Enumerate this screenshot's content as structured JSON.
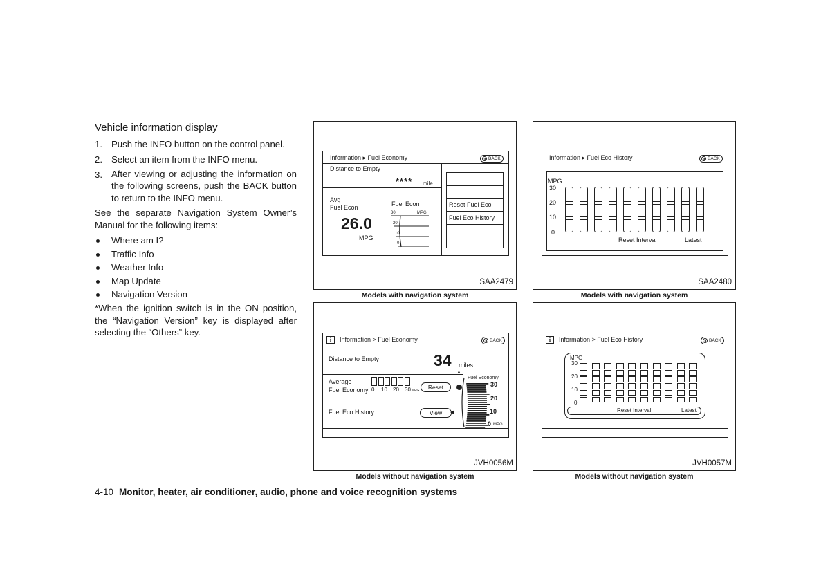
{
  "left_column": {
    "section_title": "Vehicle information display",
    "steps": [
      {
        "num": "1.",
        "text": "Push the INFO button on the control panel."
      },
      {
        "num": "2.",
        "text": "Select an item from the INFO menu."
      },
      {
        "num": "3.",
        "text": "After viewing or adjusting the information on the following screens, push the BACK button to return to the INFO menu."
      }
    ],
    "see_text": "See the separate Navigation System Owner’s Manual for the following items:",
    "bullets": [
      "Where am I?",
      "Traffic Info",
      "Weather Info",
      "Map Update",
      "Navigation Version"
    ],
    "note": "*When the ignition switch is in the ON position, the “Navigation Version” key is displayed after selecting the “Others” key."
  },
  "figures": [
    {
      "code": "SAA2479",
      "caption": "Models with navigation system",
      "screen": {
        "breadcrumb": "Information ▸ Fuel Economy",
        "back_label": "BACK",
        "distance_label": "Distance to Empty",
        "distance_value": "****",
        "distance_unit": "mile",
        "avg_label_1": "Avg",
        "avg_label_2": "Fuel Econ",
        "avg_value": "26.0",
        "avg_unit": "MPG",
        "gauge_title": "Fuel Econ",
        "gauge_ticks": [
          "30",
          "20",
          "10",
          "0"
        ],
        "gauge_unit": "MPG",
        "menu_items": [
          "",
          "",
          "Reset Fuel Eco",
          "Fuel Eco History",
          ""
        ]
      }
    },
    {
      "code": "SAA2480",
      "caption": "Models with navigation system",
      "screen": {
        "breadcrumb": "Information ▸ Fuel Eco History",
        "back_label": "BACK",
        "y_label": "MPG",
        "y_ticks": [
          "30",
          "20",
          "10",
          "0"
        ],
        "x_left_label": "Reset Interval",
        "x_right_label": "Latest",
        "bar_count": 10
      }
    },
    {
      "code": "JVH0056M",
      "caption": "Models without navigation system",
      "screen": {
        "info_icon": "i",
        "breadcrumb": "Information > Fuel Economy",
        "back_label": "BACK",
        "distance_label": "Distance to Empty",
        "distance_value": "34",
        "distance_unit": "miles",
        "avg_label_1": "Average",
        "avg_label_2": "Fuel Economy",
        "avg_scale": [
          "0",
          "10",
          "20",
          "30"
        ],
        "avg_scale_unit": "MPG",
        "reset_label": "Reset",
        "history_label": "Fuel Eco History",
        "view_label": "View",
        "gauge_title": "Fuel Economy",
        "gauge_ticks": [
          "30",
          "20",
          "10",
          "0"
        ],
        "gauge_unit": "MPG"
      }
    },
    {
      "code": "JVH0057M",
      "caption": "Models without navigation system",
      "screen": {
        "info_icon": "i",
        "breadcrumb": "Information > Fuel Eco History",
        "back_label": "BACK",
        "y_label": "MPG",
        "y_ticks": [
          "30",
          "20",
          "10",
          "0"
        ],
        "x_left_label": "Reset Interval",
        "x_right_label": "Latest",
        "bar_count": 10
      }
    }
  ],
  "footer": {
    "page_number": "4-10",
    "title": "Monitor, heater, air conditioner, audio, phone and voice recognition systems"
  }
}
